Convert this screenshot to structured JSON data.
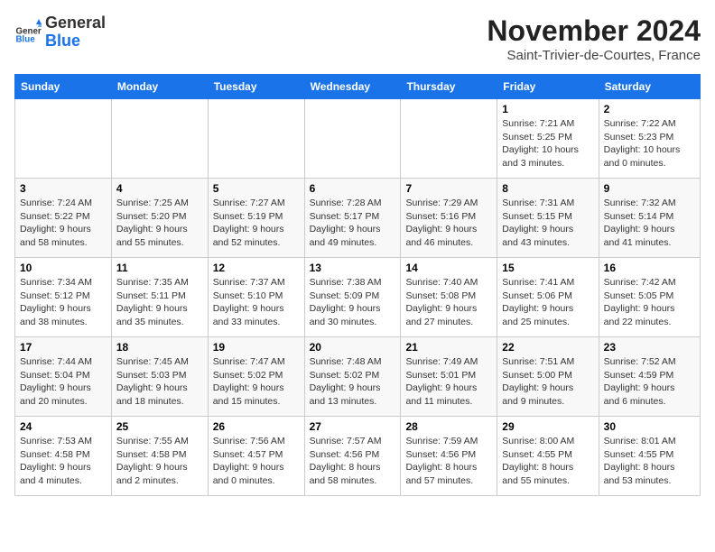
{
  "logo": {
    "general": "General",
    "blue": "Blue"
  },
  "header": {
    "month": "November 2024",
    "location": "Saint-Trivier-de-Courtes, France"
  },
  "weekdays": [
    "Sunday",
    "Monday",
    "Tuesday",
    "Wednesday",
    "Thursday",
    "Friday",
    "Saturday"
  ],
  "weeks": [
    [
      {
        "day": "",
        "info": ""
      },
      {
        "day": "",
        "info": ""
      },
      {
        "day": "",
        "info": ""
      },
      {
        "day": "",
        "info": ""
      },
      {
        "day": "",
        "info": ""
      },
      {
        "day": "1",
        "info": "Sunrise: 7:21 AM\nSunset: 5:25 PM\nDaylight: 10 hours\nand 3 minutes."
      },
      {
        "day": "2",
        "info": "Sunrise: 7:22 AM\nSunset: 5:23 PM\nDaylight: 10 hours\nand 0 minutes."
      }
    ],
    [
      {
        "day": "3",
        "info": "Sunrise: 7:24 AM\nSunset: 5:22 PM\nDaylight: 9 hours\nand 58 minutes."
      },
      {
        "day": "4",
        "info": "Sunrise: 7:25 AM\nSunset: 5:20 PM\nDaylight: 9 hours\nand 55 minutes."
      },
      {
        "day": "5",
        "info": "Sunrise: 7:27 AM\nSunset: 5:19 PM\nDaylight: 9 hours\nand 52 minutes."
      },
      {
        "day": "6",
        "info": "Sunrise: 7:28 AM\nSunset: 5:17 PM\nDaylight: 9 hours\nand 49 minutes."
      },
      {
        "day": "7",
        "info": "Sunrise: 7:29 AM\nSunset: 5:16 PM\nDaylight: 9 hours\nand 46 minutes."
      },
      {
        "day": "8",
        "info": "Sunrise: 7:31 AM\nSunset: 5:15 PM\nDaylight: 9 hours\nand 43 minutes."
      },
      {
        "day": "9",
        "info": "Sunrise: 7:32 AM\nSunset: 5:14 PM\nDaylight: 9 hours\nand 41 minutes."
      }
    ],
    [
      {
        "day": "10",
        "info": "Sunrise: 7:34 AM\nSunset: 5:12 PM\nDaylight: 9 hours\nand 38 minutes."
      },
      {
        "day": "11",
        "info": "Sunrise: 7:35 AM\nSunset: 5:11 PM\nDaylight: 9 hours\nand 35 minutes."
      },
      {
        "day": "12",
        "info": "Sunrise: 7:37 AM\nSunset: 5:10 PM\nDaylight: 9 hours\nand 33 minutes."
      },
      {
        "day": "13",
        "info": "Sunrise: 7:38 AM\nSunset: 5:09 PM\nDaylight: 9 hours\nand 30 minutes."
      },
      {
        "day": "14",
        "info": "Sunrise: 7:40 AM\nSunset: 5:08 PM\nDaylight: 9 hours\nand 27 minutes."
      },
      {
        "day": "15",
        "info": "Sunrise: 7:41 AM\nSunset: 5:06 PM\nDaylight: 9 hours\nand 25 minutes."
      },
      {
        "day": "16",
        "info": "Sunrise: 7:42 AM\nSunset: 5:05 PM\nDaylight: 9 hours\nand 22 minutes."
      }
    ],
    [
      {
        "day": "17",
        "info": "Sunrise: 7:44 AM\nSunset: 5:04 PM\nDaylight: 9 hours\nand 20 minutes."
      },
      {
        "day": "18",
        "info": "Sunrise: 7:45 AM\nSunset: 5:03 PM\nDaylight: 9 hours\nand 18 minutes."
      },
      {
        "day": "19",
        "info": "Sunrise: 7:47 AM\nSunset: 5:02 PM\nDaylight: 9 hours\nand 15 minutes."
      },
      {
        "day": "20",
        "info": "Sunrise: 7:48 AM\nSunset: 5:02 PM\nDaylight: 9 hours\nand 13 minutes."
      },
      {
        "day": "21",
        "info": "Sunrise: 7:49 AM\nSunset: 5:01 PM\nDaylight: 9 hours\nand 11 minutes."
      },
      {
        "day": "22",
        "info": "Sunrise: 7:51 AM\nSunset: 5:00 PM\nDaylight: 9 hours\nand 9 minutes."
      },
      {
        "day": "23",
        "info": "Sunrise: 7:52 AM\nSunset: 4:59 PM\nDaylight: 9 hours\nand 6 minutes."
      }
    ],
    [
      {
        "day": "24",
        "info": "Sunrise: 7:53 AM\nSunset: 4:58 PM\nDaylight: 9 hours\nand 4 minutes."
      },
      {
        "day": "25",
        "info": "Sunrise: 7:55 AM\nSunset: 4:58 PM\nDaylight: 9 hours\nand 2 minutes."
      },
      {
        "day": "26",
        "info": "Sunrise: 7:56 AM\nSunset: 4:57 PM\nDaylight: 9 hours\nand 0 minutes."
      },
      {
        "day": "27",
        "info": "Sunrise: 7:57 AM\nSunset: 4:56 PM\nDaylight: 8 hours\nand 58 minutes."
      },
      {
        "day": "28",
        "info": "Sunrise: 7:59 AM\nSunset: 4:56 PM\nDaylight: 8 hours\nand 57 minutes."
      },
      {
        "day": "29",
        "info": "Sunrise: 8:00 AM\nSunset: 4:55 PM\nDaylight: 8 hours\nand 55 minutes."
      },
      {
        "day": "30",
        "info": "Sunrise: 8:01 AM\nSunset: 4:55 PM\nDaylight: 8 hours\nand 53 minutes."
      }
    ]
  ]
}
